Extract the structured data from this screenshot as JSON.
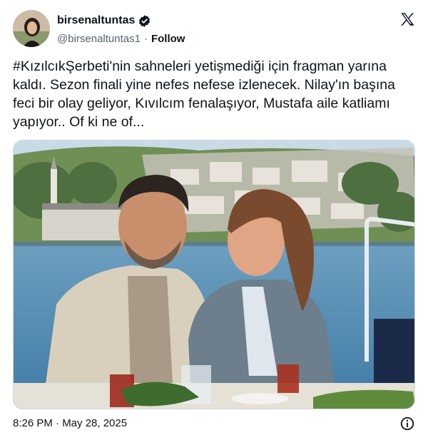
{
  "author": {
    "display_name": "birsenaltuntas",
    "handle": "@birsenaltuntas1",
    "follow_label": "Follow",
    "verified": true
  },
  "tweet": {
    "text": "#KızılcıkŞerbeti'nin sahneleri yetişmediği için fragman yarına kaldı. Sezon finali yine nefes nefese izlenecek. Nilay'ın başına feci bir olay geliyor, Kıvılcım fenalaşıyor, Mustafa aile katliamı yapıyor.. Of ki ne of...",
    "timestamp": "8:26 PM · May 28, 2025"
  },
  "icons": {
    "brand": "x-logo-icon",
    "verified": "verified-badge-icon",
    "info": "info-icon"
  },
  "colors": {
    "text": "#0f1419",
    "muted": "#536471",
    "verified_badge": "#0f1419",
    "border": "#cfd9de"
  }
}
